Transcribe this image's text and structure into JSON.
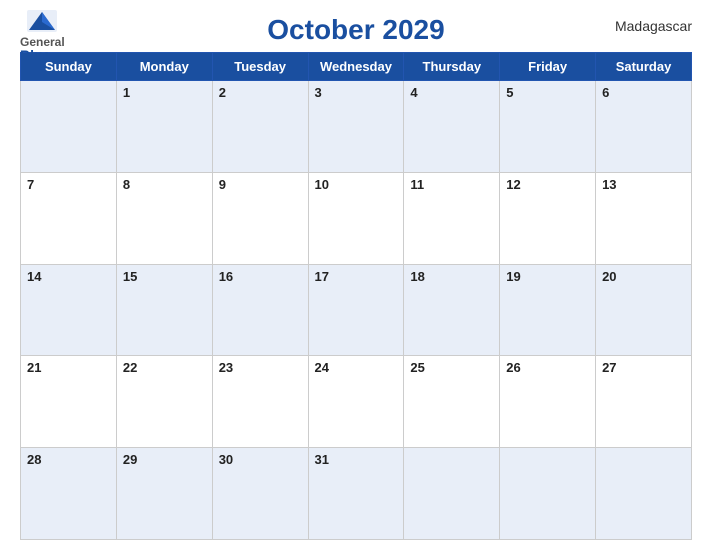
{
  "header": {
    "logo_general": "General",
    "logo_blue": "Blue",
    "month_title": "October 2029",
    "country": "Madagascar"
  },
  "weekdays": [
    "Sunday",
    "Monday",
    "Tuesday",
    "Wednesday",
    "Thursday",
    "Friday",
    "Saturday"
  ],
  "weeks": [
    [
      "",
      "1",
      "2",
      "3",
      "4",
      "5",
      "6"
    ],
    [
      "7",
      "8",
      "9",
      "10",
      "11",
      "12",
      "13"
    ],
    [
      "14",
      "15",
      "16",
      "17",
      "18",
      "19",
      "20"
    ],
    [
      "21",
      "22",
      "23",
      "24",
      "25",
      "26",
      "27"
    ],
    [
      "28",
      "29",
      "30",
      "31",
      "",
      "",
      ""
    ]
  ]
}
